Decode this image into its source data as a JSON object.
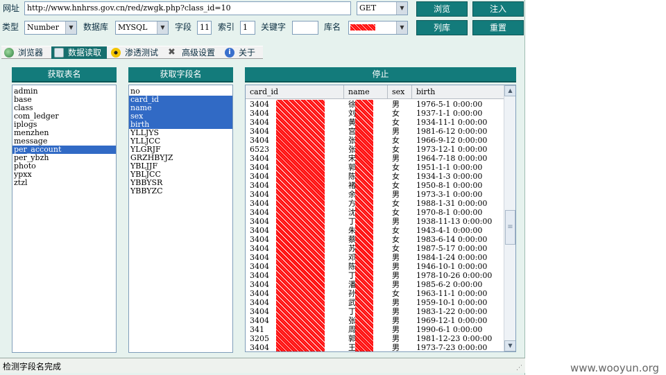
{
  "toolbar": {
    "url_label": "网址",
    "url_value": "http://www.hnhrss.gov.cn/red/zwgk.php?class_id=10",
    "method": "GET",
    "type_label": "类型",
    "type_value": "Number",
    "db_label": "数据库",
    "db_value": "MYSQL",
    "field_label": "字段",
    "field_value": "11",
    "index_label": "索引",
    "index_value": "1",
    "keyword_label": "关键字",
    "keyword_value": "",
    "dbname_label": "库名",
    "browse_btn": "浏览",
    "inject_btn": "注入",
    "listdb_btn": "列库",
    "reset_btn": "重置"
  },
  "tabs": [
    {
      "label": "浏览器",
      "icon": "globe-icon"
    },
    {
      "label": "数据读取",
      "icon": "database-icon"
    },
    {
      "label": "渗透测试",
      "icon": "radiation-icon"
    },
    {
      "label": "高级设置",
      "icon": "tools-icon"
    },
    {
      "label": "关于",
      "icon": "info-icon"
    }
  ],
  "tables_panel": {
    "title": "获取表名",
    "items": [
      "admin",
      "base",
      "class",
      "com_ledger",
      "iplogs",
      "menzhen",
      "message",
      "per_account",
      "per_ybzh",
      "photo",
      "ypxx",
      "ztzl"
    ],
    "selected": [
      "per_account"
    ]
  },
  "fields_panel": {
    "title": "获取字段名",
    "items": [
      "no",
      "card_id",
      "name",
      "sex",
      "birth",
      "YLLJYS",
      "YLLJCC",
      "YLGRJF",
      "GRZHBYJZ",
      "YBLJJF",
      "YBLJCC",
      "YBBYSR",
      "YBBYZC"
    ],
    "selected": [
      "card_id",
      "name",
      "sex",
      "birth"
    ]
  },
  "data_panel": {
    "title": "停止",
    "columns": [
      "card_id",
      "name",
      "sex",
      "birth"
    ],
    "rows": [
      {
        "card_id": "3404",
        "name": "徐",
        "sex": "男",
        "birth": "1976-5-1 0:00:00"
      },
      {
        "card_id": "3404",
        "name": "刘",
        "sex": "女",
        "birth": "1937-1-1 0:00:00"
      },
      {
        "card_id": "3404",
        "name": "黄",
        "sex": "女",
        "birth": "1934-11-1 0:00:00"
      },
      {
        "card_id": "3404",
        "name": "宫",
        "sex": "男",
        "birth": "1981-6-12 0:00:00"
      },
      {
        "card_id": "3404",
        "name": "张",
        "sex": "女",
        "birth": "1966-9-12 0:00:00"
      },
      {
        "card_id": "6523",
        "name": "张",
        "sex": "女",
        "birth": "1973-12-1 0:00:00"
      },
      {
        "card_id": "3404",
        "name": "宋",
        "sex": "男",
        "birth": "1964-7-18 0:00:00"
      },
      {
        "card_id": "3404",
        "name": "郭",
        "sex": "女",
        "birth": "1951-1-1 0:00:00"
      },
      {
        "card_id": "3404",
        "name": "陈",
        "sex": "女",
        "birth": "1934-1-3 0:00:00"
      },
      {
        "card_id": "3404",
        "name": "褚",
        "sex": "女",
        "birth": "1950-8-1 0:00:00"
      },
      {
        "card_id": "3404",
        "name": "余",
        "sex": "男",
        "birth": "1973-3-1 0:00:00"
      },
      {
        "card_id": "3404",
        "name": "方",
        "sex": "女",
        "birth": "1988-1-31 0:00:00"
      },
      {
        "card_id": "3404",
        "name": "沈",
        "sex": "女",
        "birth": "1970-8-1 0:00:00"
      },
      {
        "card_id": "3404",
        "name": "丁",
        "sex": "男",
        "birth": "1938-11-13 0:00:00"
      },
      {
        "card_id": "3404",
        "name": "朱",
        "sex": "女",
        "birth": "1943-4-1 0:00:00"
      },
      {
        "card_id": "3404",
        "name": "蔡",
        "sex": "女",
        "birth": "1983-6-14 0:00:00"
      },
      {
        "card_id": "3404",
        "name": "苏",
        "sex": "女",
        "birth": "1987-5-17 0:00:00"
      },
      {
        "card_id": "3404",
        "name": "邓",
        "sex": "男",
        "birth": "1984-1-24 0:00:00"
      },
      {
        "card_id": "3404",
        "name": "陈",
        "sex": "男",
        "birth": "1946-10-1 0:00:00"
      },
      {
        "card_id": "3404",
        "name": "丁",
        "sex": "男",
        "birth": "1978-10-26 0:00:00"
      },
      {
        "card_id": "3404",
        "name": "潘",
        "sex": "男",
        "birth": "1985-6-2 0:00:00"
      },
      {
        "card_id": "3404",
        "name": "孙",
        "sex": "女",
        "birth": "1963-11-1 0:00:00"
      },
      {
        "card_id": "3404",
        "name": "武",
        "sex": "男",
        "birth": "1959-10-1 0:00:00"
      },
      {
        "card_id": "3404",
        "name": "丁",
        "sex": "男",
        "birth": "1983-1-22 0:00:00"
      },
      {
        "card_id": "3404",
        "name": "张",
        "sex": "男",
        "birth": "1969-12-1 0:00:00"
      },
      {
        "card_id": "341",
        "name": "周",
        "sex": "男",
        "birth": "1990-6-1 0:00:00"
      },
      {
        "card_id": "3205",
        "name": "郭",
        "sex": "男",
        "birth": "1981-12-23 0:00:00"
      },
      {
        "card_id": "3404",
        "name": "王",
        "sex": "男",
        "birth": "1973-7-23 0:00:00"
      }
    ]
  },
  "status": "检测字段名完成",
  "watermark": "www.wooyun.org"
}
